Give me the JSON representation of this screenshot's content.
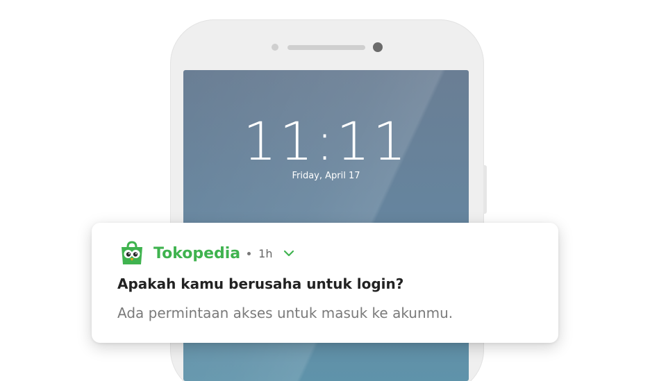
{
  "lockscreen": {
    "time": "11:11",
    "date": "Friday, April 17"
  },
  "notification": {
    "app_name": "Tokopedia",
    "time_ago": "1h",
    "title": "Apakah kamu berusaha untuk login?",
    "message": "Ada permintaan akses untuk masuk ke akunmu.",
    "app_icon": "tokopedia-owl-icon",
    "expand_icon": "chevron-down-icon",
    "accent_color": "#3fb34f"
  }
}
